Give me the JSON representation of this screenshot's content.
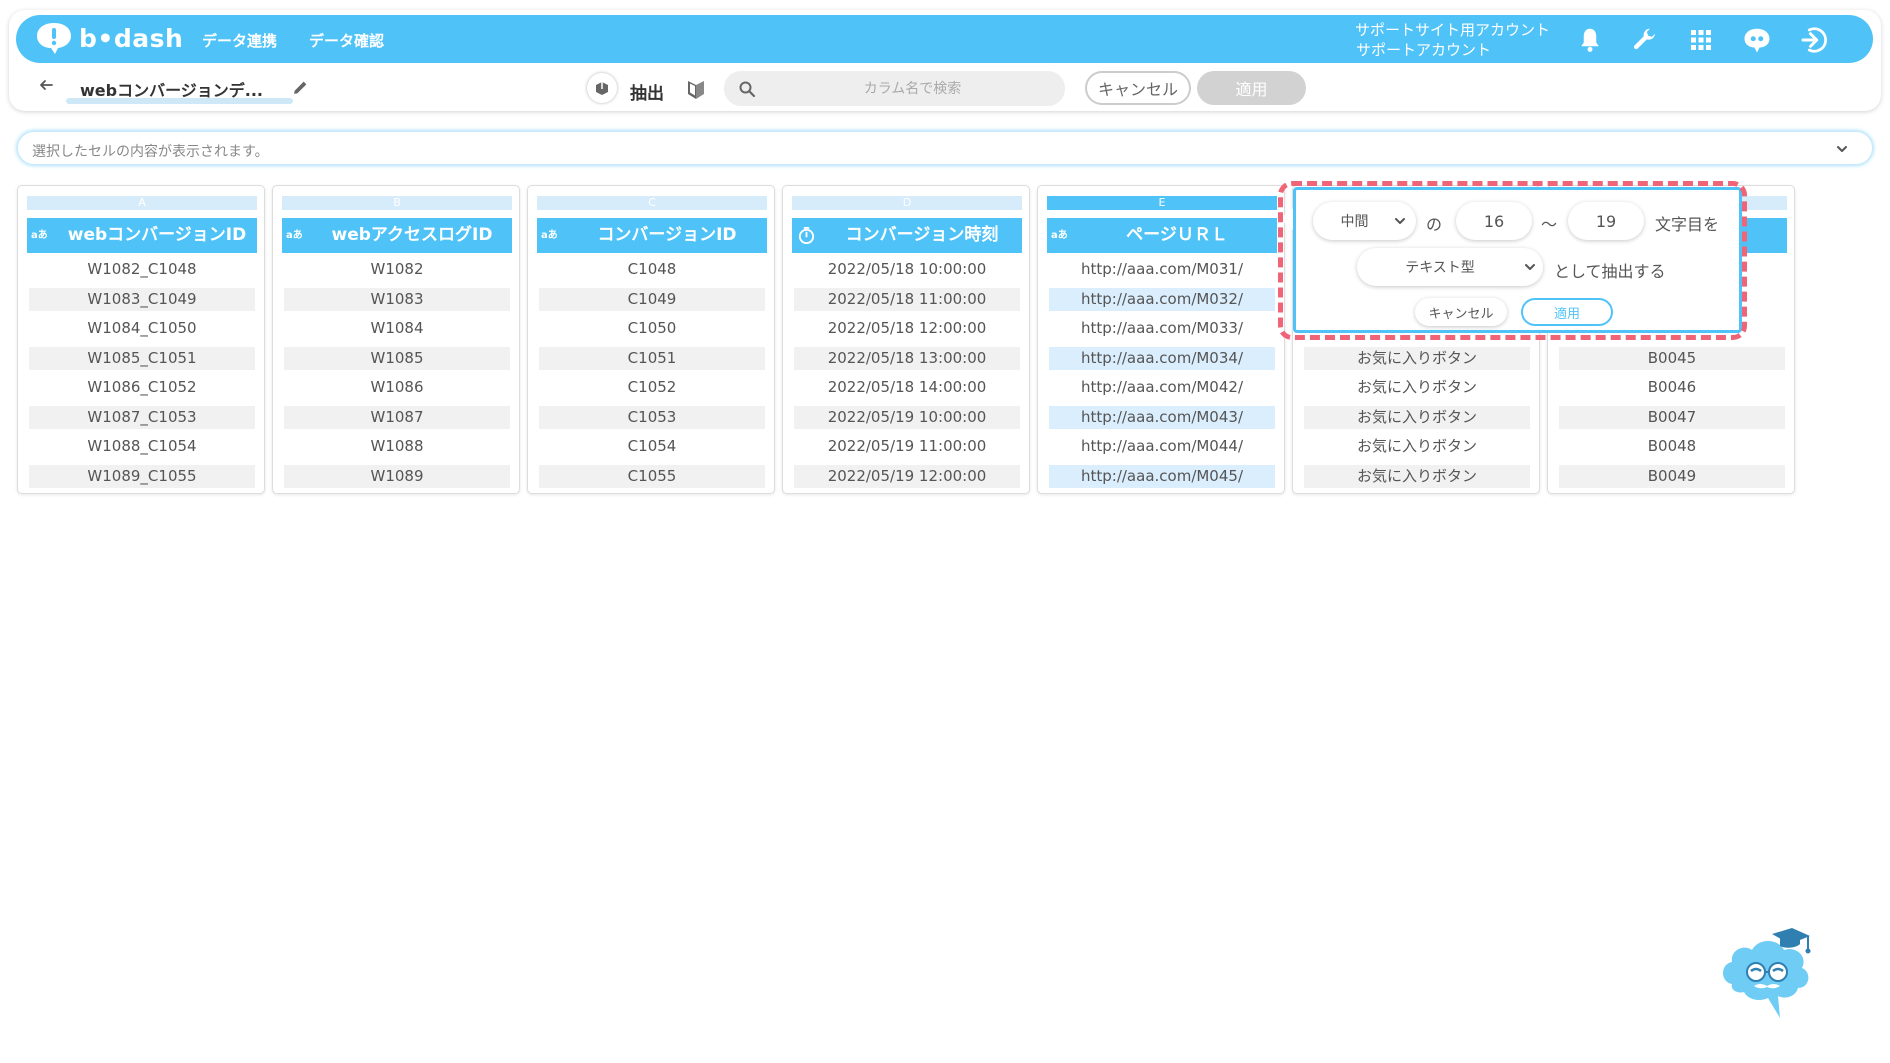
{
  "header": {
    "logo_text": "b•dash",
    "nav": [
      "データ連携",
      "データ確認"
    ],
    "account_line1": "サポートサイト用アカウント",
    "account_line2": "サポートアカウント",
    "icons": [
      "bell-icon",
      "wrench-icon",
      "apps-grid-icon",
      "chat-mascot-icon",
      "logout-icon"
    ],
    "brand_color": "#4fc3f7"
  },
  "subbar": {
    "title": "webコンバージョンデ...",
    "extract_label": "抽出",
    "search_placeholder": "カラム名で検索",
    "search_value": "",
    "cancel_label": "キャンセル",
    "apply_label": "適用"
  },
  "cell_bar": {
    "text": "選択したセルの内容が表示されます。"
  },
  "columns": [
    {
      "letter": "A",
      "badge": "aあ",
      "name": "webコンバージョンID",
      "cells": [
        "W1082_C1048",
        "W1083_C1049",
        "W1084_C1050",
        "W1085_C1051",
        "W1086_C1052",
        "W1087_C1053",
        "W1088_C1054",
        "W1089_C1055"
      ]
    },
    {
      "letter": "B",
      "badge": "aあ",
      "name": "webアクセスログID",
      "cells": [
        "W1082",
        "W1083",
        "W1084",
        "W1085",
        "W1086",
        "W1087",
        "W1088",
        "W1089"
      ]
    },
    {
      "letter": "C",
      "badge": "aあ",
      "name": "コンバージョンID",
      "cells": [
        "C1048",
        "C1049",
        "C1050",
        "C1051",
        "C1052",
        "C1053",
        "C1054",
        "C1055"
      ]
    },
    {
      "letter": "D",
      "badge": "",
      "name": "コンバージョン時刻",
      "cells": [
        "2022/05/18 10:00:00",
        "2022/05/18 11:00:00",
        "2022/05/18 12:00:00",
        "2022/05/18 13:00:00",
        "2022/05/18 14:00:00",
        "2022/05/19 10:00:00",
        "2022/05/19 11:00:00",
        "2022/05/19 12:00:00"
      ]
    },
    {
      "letter": "E",
      "badge": "aあ",
      "name": "ページＵＲＬ",
      "cells": [
        "http://aaa.com/M031/",
        "http://aaa.com/M032/",
        "http://aaa.com/M033/",
        "http://aaa.com/M034/",
        "http://aaa.com/M042/",
        "http://aaa.com/M043/",
        "http://aaa.com/M044/",
        "http://aaa.com/M045/"
      ]
    },
    {
      "letter": "",
      "badge": "",
      "name": "",
      "cells": [
        "",
        "",
        "",
        "お気に入りボタン",
        "お気に入りボタン",
        "お気に入りボタン",
        "お気に入りボタン",
        "お気に入りボタン"
      ]
    },
    {
      "letter": "",
      "badge": "",
      "name": "",
      "cells": [
        "",
        "",
        "",
        "B0045",
        "B0046",
        "B0047",
        "B0048",
        "B0049"
      ]
    }
  ],
  "popover": {
    "position_select": "中間",
    "no": "の",
    "from": "16",
    "tilde": "〜",
    "to": "19",
    "chars_suffix": "文字目を",
    "type_select": "テキスト型",
    "extract_suffix": "として抽出する",
    "cancel_label": "キャンセル",
    "apply_label": "適用",
    "highlight_color": "#f06478"
  }
}
